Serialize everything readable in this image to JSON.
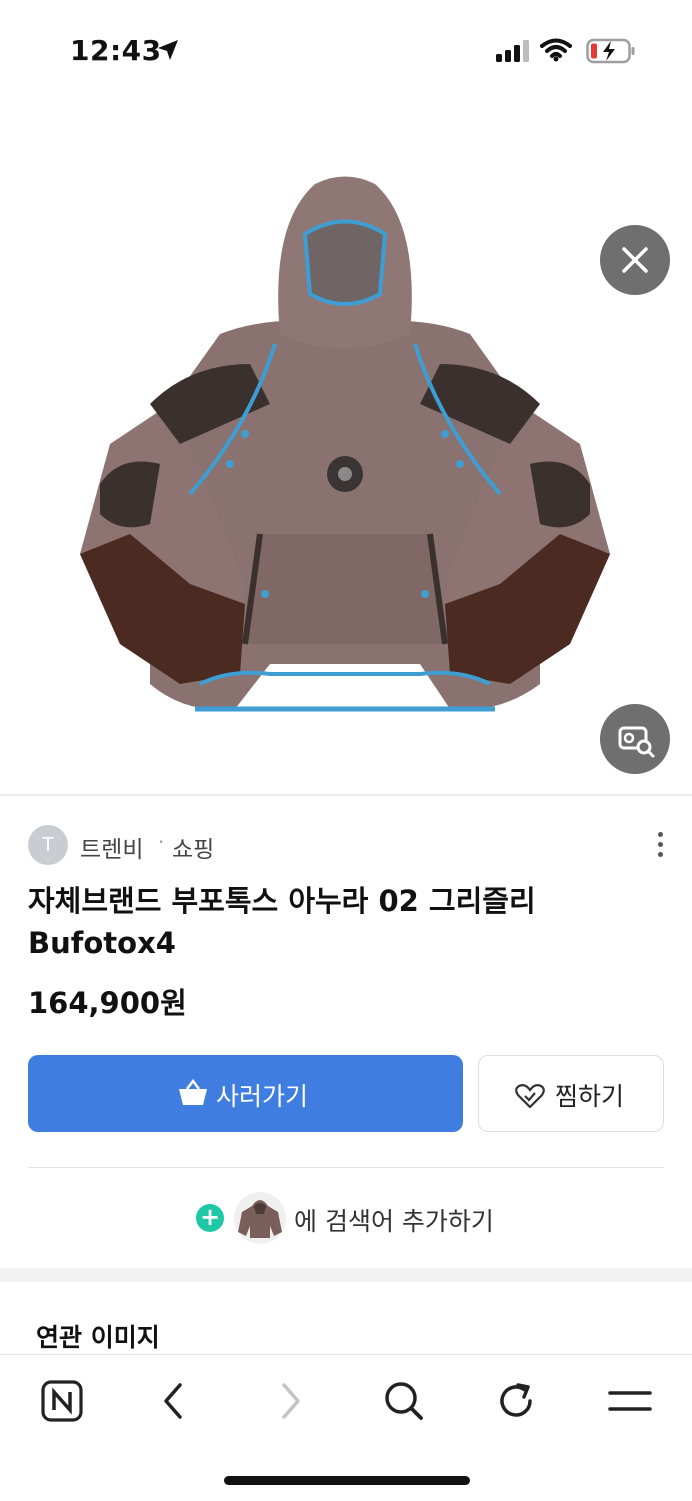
{
  "status_bar": {
    "time": "12:43"
  },
  "hero": {
    "product_image": "product-hoodie-image",
    "close_icon": "close-icon",
    "lens_icon": "image-search-icon"
  },
  "source": {
    "avatar_letter": "T",
    "name": "트렌비",
    "separator": "·",
    "type": "쇼핑"
  },
  "product": {
    "title": "자체브랜드 부포톡스 아누라 02 그리즐리 Bufotox4",
    "price": "164,900원"
  },
  "actions": {
    "buy_label": "사러가기",
    "wish_label": "찜하기"
  },
  "keyword": {
    "add_label": "에 검색어 추가하기"
  },
  "related": {
    "title": "연관 이미지"
  },
  "toolbar": {
    "items": [
      "naver-home-icon",
      "back-icon",
      "forward-icon",
      "search-icon",
      "refresh-icon",
      "menu-icon"
    ]
  },
  "colors": {
    "accent": "#3f7ee0",
    "plus": "#1fc8a4"
  }
}
